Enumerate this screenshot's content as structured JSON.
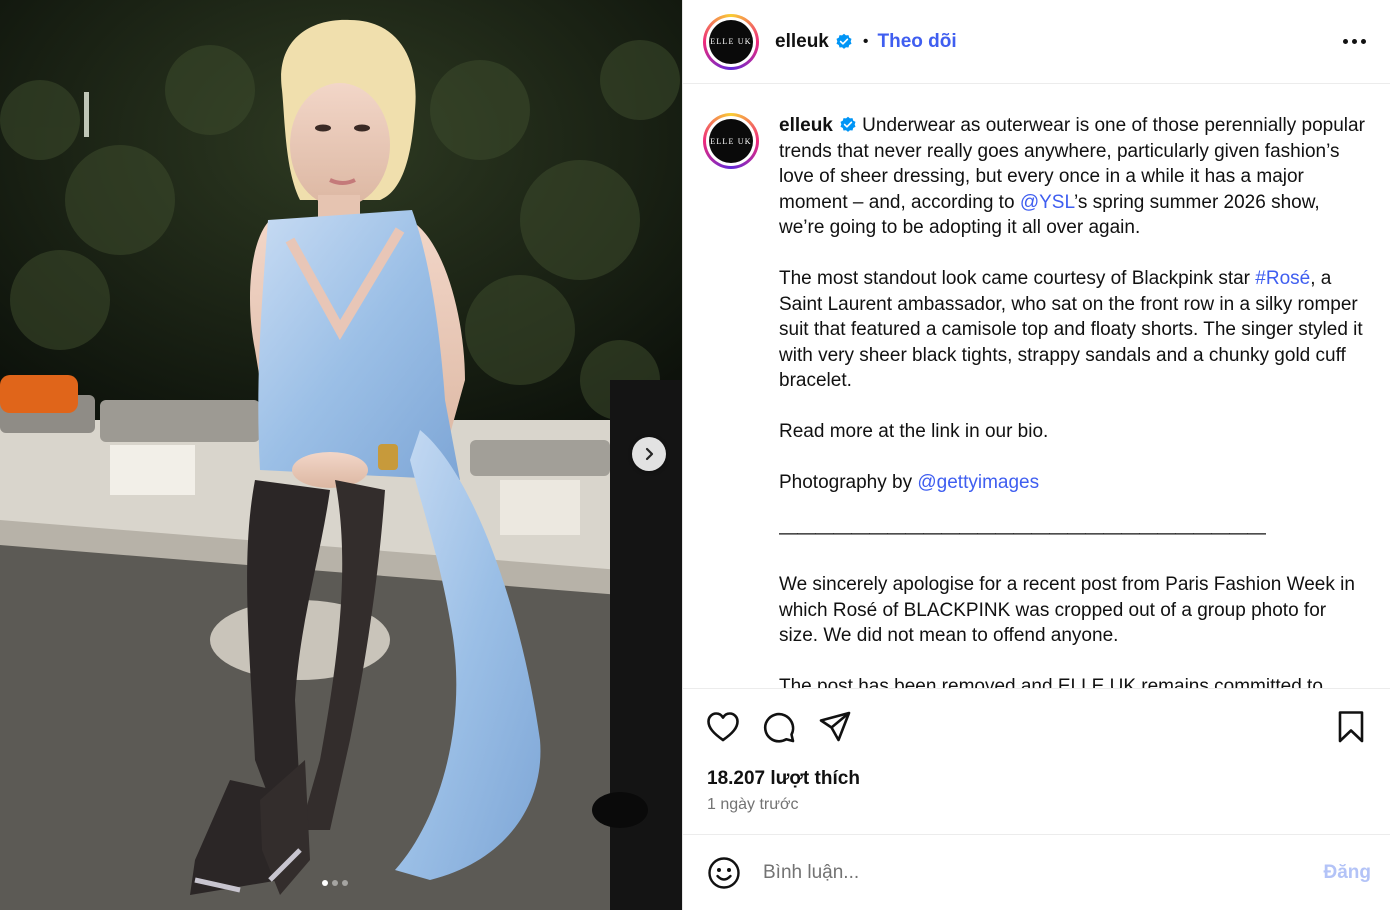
{
  "post": {
    "username": "elleuk",
    "follow_label": "Theo dõi",
    "avatar_text": "ELLE UK",
    "caption": {
      "username": "elleuk",
      "p1_pre": "Underwear as outerwear is one of those perennially popular trends that never really goes anywhere, particularly given fashion’s love of sheer dressing, but every once in a while it has a major moment – and, according to ",
      "p1_mention": "@YSL",
      "p1_post": "’s spring summer 2026 show, we’re going to be adopting it all over again.",
      "p2_pre": "The most standout look came courtesy of Blackpink star ",
      "p2_hashtag": "#Rosé",
      "p2_post": ", a Saint Laurent ambassador, who sat on the front row in a silky romper suit that featured a camisole top and floaty shorts. The singer styled it with very sheer black tights, strappy sandals and a chunky gold cuff bracelet.",
      "p3": "Read more at the link in our bio.",
      "p4_pre": "Photography by ",
      "p4_mention": "@gettyimages",
      "divider": "———————————————————————————",
      "p5": "We sincerely apologise for a recent post from Paris Fashion Week in which Rosé of BLACKPINK was cropped out of a group photo for size. We did not mean to offend anyone.",
      "p6": "The post has been removed and ELLE UK remains committed to"
    },
    "likes_text": "18.207 lượt thích",
    "time_text": "1 ngày trước",
    "comment_placeholder": "Bình luận...",
    "post_label": "Đăng"
  },
  "carousel": {
    "total_slides": 3,
    "current_slide": 1
  },
  "icons": {
    "verified": "verified-badge-icon",
    "like": "heart-icon",
    "comment": "comment-bubble-icon",
    "share": "paper-plane-icon",
    "save": "bookmark-icon",
    "emoji": "smiley-icon",
    "next": "chevron-right-icon",
    "more": "more-options-icon"
  },
  "colors": {
    "link": "#3f5ef0",
    "verified": "#0095f6",
    "post_disabled": "#b3c3f7",
    "muted": "#737373"
  }
}
